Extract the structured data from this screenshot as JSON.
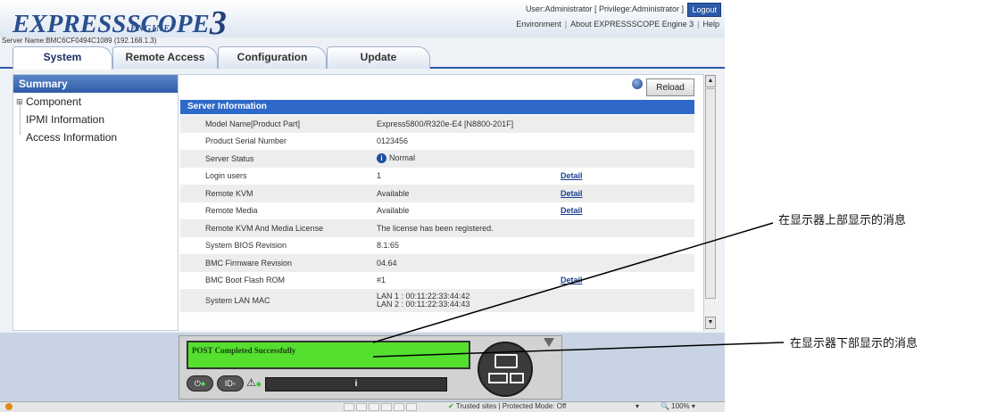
{
  "header": {
    "logo_main": "EXPRESSSCOPE",
    "logo_num": "3",
    "logo_sub": "ENGINE",
    "user_info": "User:Administrator [ Privilege:Administrator ]",
    "logout": "Logout",
    "links": [
      "Environment",
      "About EXPRESSSCOPE Engine 3",
      "Help"
    ],
    "server_name": "Server Name:BMC6CF0494C1089 (192.168.1.3)"
  },
  "tabs": [
    {
      "label": "System",
      "active": true
    },
    {
      "label": "Remote Access",
      "active": false
    },
    {
      "label": "Configuration",
      "active": false
    },
    {
      "label": "Update",
      "active": false
    }
  ],
  "sidebar": {
    "summary": "Summary",
    "items": [
      "Component",
      "IPMI Information",
      "Access Information"
    ]
  },
  "main": {
    "reload": "Reload",
    "section_title": "Server Information",
    "rows": [
      {
        "label": "Model Name[Product Part]",
        "value": "Express5800/R320e-E4 [N8800-201F]",
        "detail": ""
      },
      {
        "label": "Product Serial Number",
        "value": "0123456",
        "detail": ""
      },
      {
        "label": "Server Status",
        "value": "Normal",
        "detail": "",
        "icon": "info-icon"
      },
      {
        "label": "Login users",
        "value": "1",
        "detail": "Detail"
      },
      {
        "label": "Remote KVM",
        "value": "Available",
        "detail": "Detail"
      },
      {
        "label": "Remote Media",
        "value": "Available",
        "detail": "Detail"
      },
      {
        "label": "Remote KVM And Media License",
        "value": "The license has been registered.",
        "detail": ""
      },
      {
        "label": "System BIOS Revision",
        "value": "8.1:65",
        "detail": ""
      },
      {
        "label": "BMC Firmware Revision",
        "value": "04.64",
        "detail": ""
      },
      {
        "label": "BMC Boot Flash ROM",
        "value": "#1",
        "detail": "Detail"
      }
    ],
    "mac": {
      "label": "System LAN MAC",
      "lan1": "LAN 1 : 00:11:22:33:44:42",
      "lan2": "LAN 2 : 00:11:22:33:44:43"
    }
  },
  "lcd": {
    "top_message": "POST Completed Successfully",
    "bottom_message": "",
    "bar_label": "i",
    "power_label": "",
    "id_label": "ID",
    "colors": {
      "lcd": "#55e02f",
      "accent": "#2e69c9"
    }
  },
  "statusbar": {
    "trusted": "Trusted sites | Protected Mode: Off",
    "zoom": "100%"
  },
  "annotations": {
    "top": "在显示器上部显示的消息",
    "bottom": "在显示器下部显示的消息"
  }
}
